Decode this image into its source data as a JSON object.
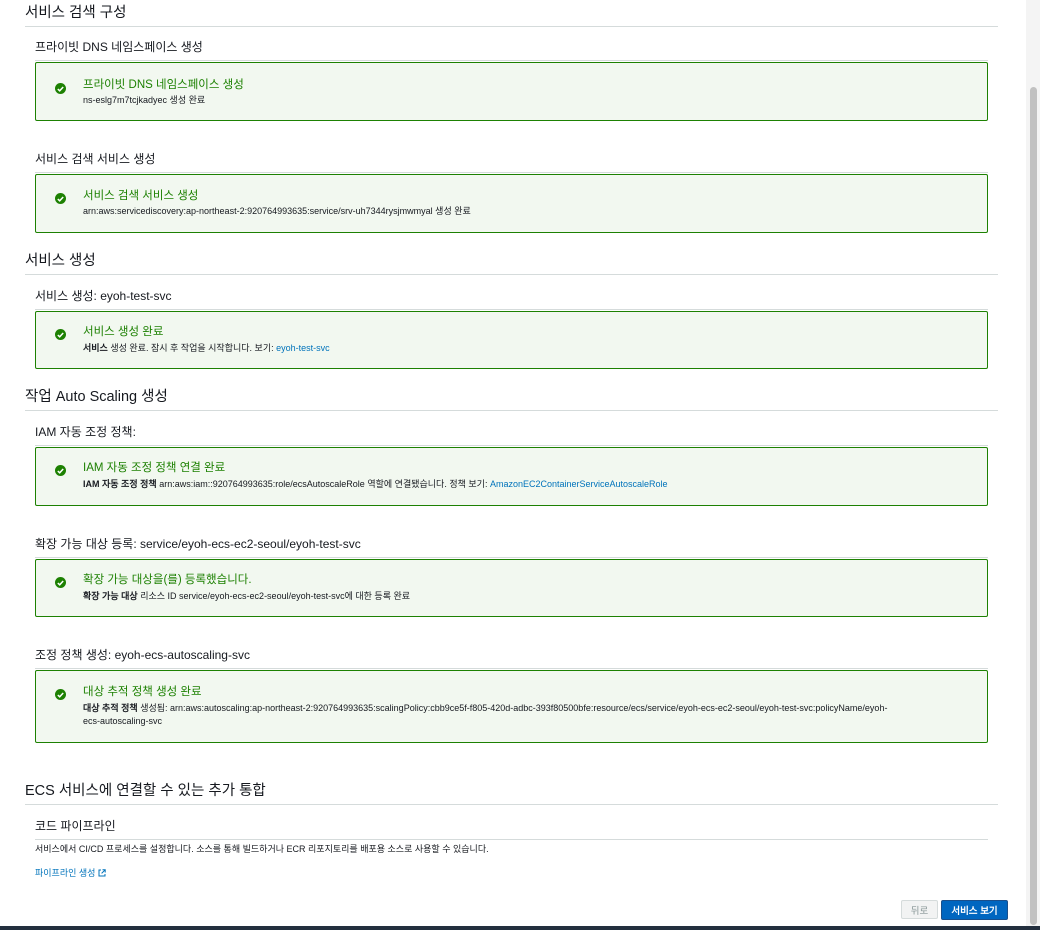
{
  "sections": {
    "service_discovery": {
      "title": "서비스 검색 구성",
      "dns": {
        "subtitle": "프라이빗 DNS 네임스페이스 생성",
        "card_title": "프라이빗 DNS 네임스페이스 생성",
        "card_desc": "ns-eslg7m7tcjkadyec 생성 완료"
      },
      "svc": {
        "subtitle": "서비스 검색 서비스 생성",
        "card_title": "서비스 검색 서비스 생성",
        "card_desc": "arn:aws:servicediscovery:ap-northeast-2:920764993635:service/srv-uh7344rysjmwmyal 생성 완료"
      }
    },
    "service_create": {
      "title": "서비스 생성",
      "subtitle": "서비스 생성: eyoh-test-svc",
      "card_title": "서비스 생성 완료",
      "card_desc_bold": "서비스",
      "card_desc_text": " 생성 완료. 잠시 후 작업을 시작합니다. 보기: ",
      "card_desc_link": "eyoh-test-svc"
    },
    "autoscaling": {
      "title": "작업 Auto Scaling 생성",
      "iam": {
        "subtitle": "IAM 자동 조정 정책:",
        "card_title": "IAM 자동 조정 정책 연결 완료",
        "card_desc_bold": "IAM 자동 조정 정책",
        "card_desc_text": " arn:aws:iam::920764993635:role/ecsAutoscaleRole 역할에 연결됐습니다. 정책 보기: ",
        "card_desc_link": "AmazonEC2ContainerServiceAutoscaleRole"
      },
      "target": {
        "subtitle": "확장 가능 대상 등록: service/eyoh-ecs-ec2-seoul/eyoh-test-svc",
        "card_title": "확장 가능 대상을(를) 등록했습니다.",
        "card_desc_bold": "확장 가능 대상",
        "card_desc_text": " 리소스 ID service/eyoh-ecs-ec2-seoul/eyoh-test-svc에 대한 등록 완료"
      },
      "policy": {
        "subtitle": "조정 정책 생성: eyoh-ecs-autoscaling-svc",
        "card_title": "대상 추적 정책 생성 완료",
        "card_desc_bold": "대상 추적 정책",
        "card_desc_text": " 생성됨: arn:aws:autoscaling:ap-northeast-2:920764993635:scalingPolicy:cbb9ce5f-f805-420d-adbc-393f80500bfe:resource/ecs/service/eyoh-ecs-ec2-seoul/eyoh-test-svc:policyName/eyoh-ecs-autoscaling-svc"
      }
    },
    "integrations": {
      "title": "ECS 서비스에 연결할 수 있는 추가 통합",
      "subtitle": "코드 파이프라인",
      "desc": "서비스에서 CI/CD 프로세스를 설정합니다. 소스를 통해 빌드하거나 ECR 리포지토리를 배포용 소스로 사용할 수 있습니다.",
      "link": "파이프라인 생성"
    }
  },
  "buttons": {
    "back": "뒤로",
    "view_service": "서비스 보기"
  },
  "icons": {
    "success": "check-circle-icon",
    "external": "external-link-icon"
  },
  "colors": {
    "success": "#1d8102",
    "success_bg": "#f2f8f0",
    "link": "#0073bb",
    "primary": "#0066c0"
  }
}
